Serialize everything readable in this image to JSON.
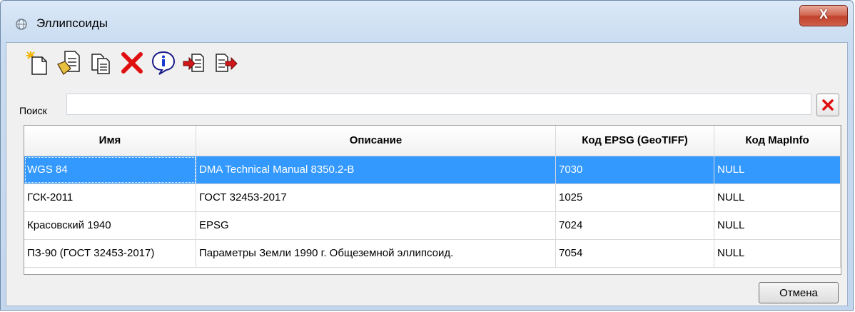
{
  "window": {
    "title": "Эллипсоиды",
    "close_glyph": "X"
  },
  "toolbar": {
    "buttons": [
      {
        "icon": "new-icon"
      },
      {
        "icon": "edit-icon"
      },
      {
        "icon": "copy-icon"
      },
      {
        "icon": "delete-icon"
      },
      {
        "icon": "info-icon"
      },
      {
        "icon": "import-icon"
      },
      {
        "icon": "export-icon"
      }
    ]
  },
  "search": {
    "label": "Поиск",
    "value": ""
  },
  "table": {
    "columns": [
      "Имя",
      "Описание",
      "Код EPSG (GeoTIFF)",
      "Код MapInfo"
    ],
    "rows": [
      [
        "WGS 84",
        "DMA Technical Manual 8350.2-B",
        "7030",
        "NULL"
      ],
      [
        "ГСК-2011",
        "ГОСТ 32453-2017",
        "1025",
        "NULL"
      ],
      [
        "Красовский 1940",
        "EPSG",
        "7024",
        "NULL"
      ],
      [
        "ПЗ-90 (ГОСТ 32453-2017)",
        "Параметры Земли 1990 г. Общеземной эллипсоид.",
        "7054",
        "NULL"
      ]
    ],
    "selected_row": 0
  },
  "footer": {
    "cancel_label": "Отмена"
  },
  "colors": {
    "selection": "#3399ff",
    "delete_red": "#e01010",
    "close_red": "#c0422b"
  }
}
